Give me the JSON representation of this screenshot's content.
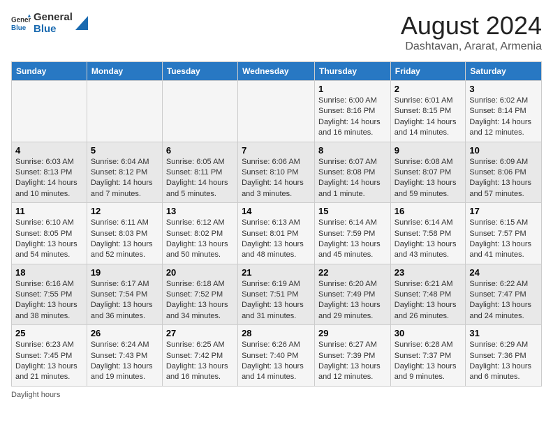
{
  "header": {
    "logo_line1": "General",
    "logo_line2": "Blue",
    "main_title": "August 2024",
    "subtitle": "Dashtavan, Ararat, Armenia"
  },
  "days_of_week": [
    "Sunday",
    "Monday",
    "Tuesday",
    "Wednesday",
    "Thursday",
    "Friday",
    "Saturday"
  ],
  "weeks": [
    [
      {
        "day": "",
        "info": ""
      },
      {
        "day": "",
        "info": ""
      },
      {
        "day": "",
        "info": ""
      },
      {
        "day": "",
        "info": ""
      },
      {
        "day": "1",
        "info": "Sunrise: 6:00 AM\nSunset: 8:16 PM\nDaylight: 14 hours\nand 16 minutes."
      },
      {
        "day": "2",
        "info": "Sunrise: 6:01 AM\nSunset: 8:15 PM\nDaylight: 14 hours\nand 14 minutes."
      },
      {
        "day": "3",
        "info": "Sunrise: 6:02 AM\nSunset: 8:14 PM\nDaylight: 14 hours\nand 12 minutes."
      }
    ],
    [
      {
        "day": "4",
        "info": "Sunrise: 6:03 AM\nSunset: 8:13 PM\nDaylight: 14 hours\nand 10 minutes."
      },
      {
        "day": "5",
        "info": "Sunrise: 6:04 AM\nSunset: 8:12 PM\nDaylight: 14 hours\nand 7 minutes."
      },
      {
        "day": "6",
        "info": "Sunrise: 6:05 AM\nSunset: 8:11 PM\nDaylight: 14 hours\nand 5 minutes."
      },
      {
        "day": "7",
        "info": "Sunrise: 6:06 AM\nSunset: 8:10 PM\nDaylight: 14 hours\nand 3 minutes."
      },
      {
        "day": "8",
        "info": "Sunrise: 6:07 AM\nSunset: 8:08 PM\nDaylight: 14 hours\nand 1 minute."
      },
      {
        "day": "9",
        "info": "Sunrise: 6:08 AM\nSunset: 8:07 PM\nDaylight: 13 hours\nand 59 minutes."
      },
      {
        "day": "10",
        "info": "Sunrise: 6:09 AM\nSunset: 8:06 PM\nDaylight: 13 hours\nand 57 minutes."
      }
    ],
    [
      {
        "day": "11",
        "info": "Sunrise: 6:10 AM\nSunset: 8:05 PM\nDaylight: 13 hours\nand 54 minutes."
      },
      {
        "day": "12",
        "info": "Sunrise: 6:11 AM\nSunset: 8:03 PM\nDaylight: 13 hours\nand 52 minutes."
      },
      {
        "day": "13",
        "info": "Sunrise: 6:12 AM\nSunset: 8:02 PM\nDaylight: 13 hours\nand 50 minutes."
      },
      {
        "day": "14",
        "info": "Sunrise: 6:13 AM\nSunset: 8:01 PM\nDaylight: 13 hours\nand 48 minutes."
      },
      {
        "day": "15",
        "info": "Sunrise: 6:14 AM\nSunset: 7:59 PM\nDaylight: 13 hours\nand 45 minutes."
      },
      {
        "day": "16",
        "info": "Sunrise: 6:14 AM\nSunset: 7:58 PM\nDaylight: 13 hours\nand 43 minutes."
      },
      {
        "day": "17",
        "info": "Sunrise: 6:15 AM\nSunset: 7:57 PM\nDaylight: 13 hours\nand 41 minutes."
      }
    ],
    [
      {
        "day": "18",
        "info": "Sunrise: 6:16 AM\nSunset: 7:55 PM\nDaylight: 13 hours\nand 38 minutes."
      },
      {
        "day": "19",
        "info": "Sunrise: 6:17 AM\nSunset: 7:54 PM\nDaylight: 13 hours\nand 36 minutes."
      },
      {
        "day": "20",
        "info": "Sunrise: 6:18 AM\nSunset: 7:52 PM\nDaylight: 13 hours\nand 34 minutes."
      },
      {
        "day": "21",
        "info": "Sunrise: 6:19 AM\nSunset: 7:51 PM\nDaylight: 13 hours\nand 31 minutes."
      },
      {
        "day": "22",
        "info": "Sunrise: 6:20 AM\nSunset: 7:49 PM\nDaylight: 13 hours\nand 29 minutes."
      },
      {
        "day": "23",
        "info": "Sunrise: 6:21 AM\nSunset: 7:48 PM\nDaylight: 13 hours\nand 26 minutes."
      },
      {
        "day": "24",
        "info": "Sunrise: 6:22 AM\nSunset: 7:47 PM\nDaylight: 13 hours\nand 24 minutes."
      }
    ],
    [
      {
        "day": "25",
        "info": "Sunrise: 6:23 AM\nSunset: 7:45 PM\nDaylight: 13 hours\nand 21 minutes."
      },
      {
        "day": "26",
        "info": "Sunrise: 6:24 AM\nSunset: 7:43 PM\nDaylight: 13 hours\nand 19 minutes."
      },
      {
        "day": "27",
        "info": "Sunrise: 6:25 AM\nSunset: 7:42 PM\nDaylight: 13 hours\nand 16 minutes."
      },
      {
        "day": "28",
        "info": "Sunrise: 6:26 AM\nSunset: 7:40 PM\nDaylight: 13 hours\nand 14 minutes."
      },
      {
        "day": "29",
        "info": "Sunrise: 6:27 AM\nSunset: 7:39 PM\nDaylight: 13 hours\nand 12 minutes."
      },
      {
        "day": "30",
        "info": "Sunrise: 6:28 AM\nSunset: 7:37 PM\nDaylight: 13 hours\nand 9 minutes."
      },
      {
        "day": "31",
        "info": "Sunrise: 6:29 AM\nSunset: 7:36 PM\nDaylight: 13 hours\nand 6 minutes."
      }
    ]
  ],
  "footer": {
    "note": "Daylight hours"
  }
}
